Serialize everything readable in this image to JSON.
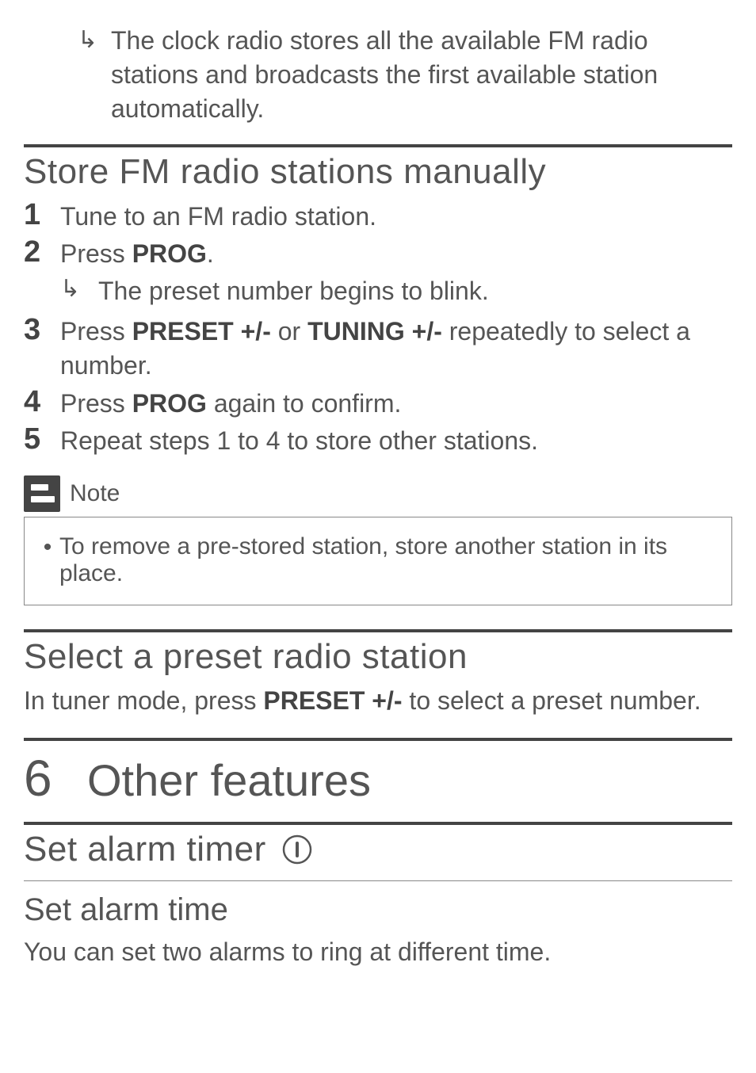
{
  "intro_result": "The clock radio stores all the available FM radio stations and broadcasts the first available station automatically.",
  "section_store": {
    "heading": "Store FM radio stations manually",
    "steps": [
      {
        "num": "1",
        "segments": [
          {
            "t": "Tune to an FM radio station."
          }
        ]
      },
      {
        "num": "2",
        "segments": [
          {
            "t": "Press "
          },
          {
            "t": "PROG",
            "b": true
          },
          {
            "t": "."
          }
        ],
        "result": "The preset number begins to blink."
      },
      {
        "num": "3",
        "segments": [
          {
            "t": "Press "
          },
          {
            "t": "PRESET +/-",
            "b": true
          },
          {
            "t": " or "
          },
          {
            "t": "TUNING +/-",
            "b": true
          },
          {
            "t": " repeatedly to select a number."
          }
        ]
      },
      {
        "num": "4",
        "segments": [
          {
            "t": "Press "
          },
          {
            "t": "PROG",
            "b": true
          },
          {
            "t": " again to confirm."
          }
        ]
      },
      {
        "num": "5",
        "segments": [
          {
            "t": "Repeat steps 1 to 4 to store other stations."
          }
        ]
      }
    ],
    "note_label": "Note",
    "note_text": "To remove a pre-stored station, store another station in its place."
  },
  "section_select": {
    "heading": "Select a preset radio station",
    "para": [
      {
        "t": "In tuner mode, press "
      },
      {
        "t": "PRESET +/-",
        "b": true
      },
      {
        "t": " to select a preset number."
      }
    ]
  },
  "chapter": {
    "num": "6",
    "title": "Other features"
  },
  "section_alarm": {
    "heading": "Set alarm timer",
    "icon": "info-circle",
    "sub_heading": "Set alarm time",
    "para": "You can set two alarms to ring at different time."
  }
}
